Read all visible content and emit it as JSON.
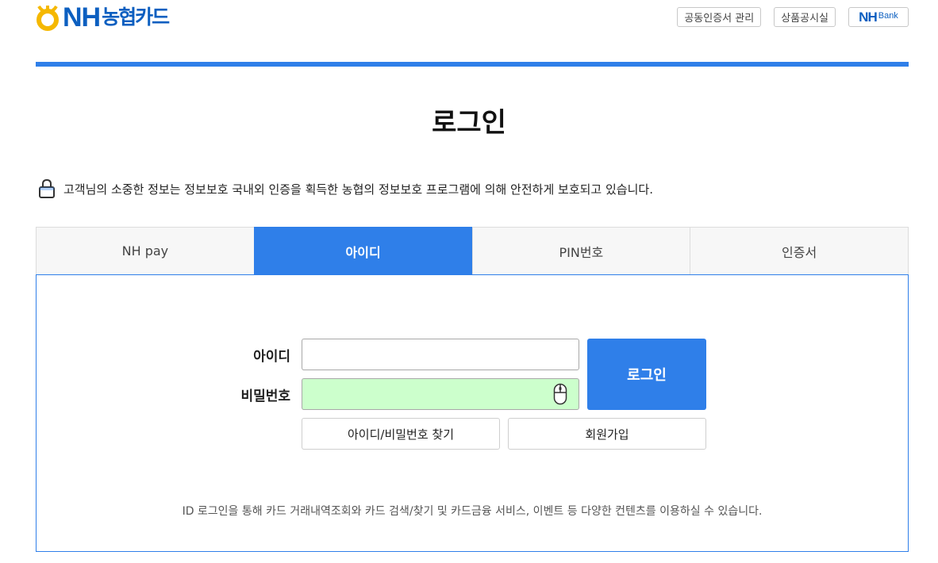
{
  "header": {
    "logo_brand": "NH",
    "logo_name": "농협카드",
    "links": [
      {
        "label": "공동인증서 관리"
      },
      {
        "label": "상품공시실"
      }
    ],
    "bank_link": {
      "brand": "NH",
      "suffix": "Bank"
    }
  },
  "page": {
    "title": "로그인",
    "notice": "고객님의 소중한 정보는 정보보호 국내외 인증을 획득한 농협의 정보보호 프로그램에 의해 안전하게 보호되고 있습니다."
  },
  "tabs": [
    {
      "label": "NH pay",
      "active": false
    },
    {
      "label": "아이디",
      "active": true
    },
    {
      "label": "PIN번호",
      "active": false
    },
    {
      "label": "인증서",
      "active": false
    }
  ],
  "form": {
    "id_label": "아이디",
    "id_value": "",
    "pw_label": "비밀번호",
    "pw_value": "",
    "login_button": "로그인",
    "find_button": "아이디/비밀번호 찾기",
    "join_button": "회원가입",
    "footnote": "ID 로그인을 통해 카드 거래내역조회와 카드 검색/찾기 및 카드금융 서비스, 이벤트 등 다양한 컨텐츠를 이용하실 수 있습니다."
  },
  "icons": {
    "logo_mark": "nh-logo-icon",
    "lock": "lock-icon",
    "mouse": "mouse-icon"
  },
  "colors": {
    "accent": "#2f7fe9",
    "brand": "#0c5fc0",
    "logo_yellow": "#f5b800",
    "password_bg": "#ccffcc"
  }
}
